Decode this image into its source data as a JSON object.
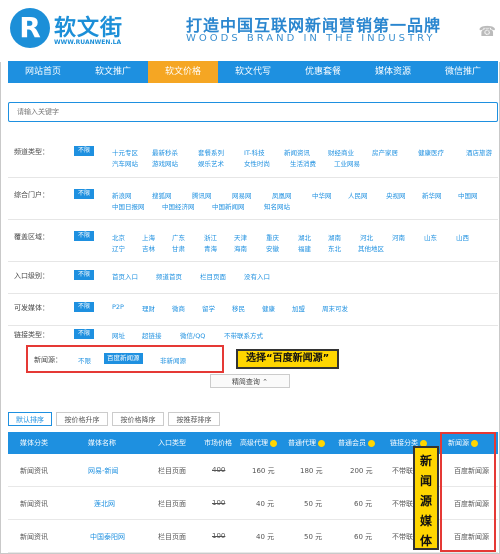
{
  "header": {
    "logo_text": "软文街",
    "logo_url": "WWW.RUANWEN.LA",
    "logo_mark": "R",
    "slogan": "打造中国互联网新闻营销第一品牌",
    "slogan_en": "WOODS BRAND IN THE INDUSTRY"
  },
  "nav": {
    "items": [
      "网站首页",
      "软文推广",
      "软文价格",
      "软文代写",
      "优惠套餐",
      "媒体资源",
      "微信推广"
    ]
  },
  "search": {
    "placeholder": "请输入关键字"
  },
  "filters": {
    "channel": {
      "label": "频道类型：",
      "all": "不限",
      "row1": [
        "十元专区",
        "最新秒杀",
        "套餐系列",
        "IT-科技",
        "新闻资讯",
        "财经商业",
        "房产家居",
        "健康医疗",
        "酒店旅游"
      ],
      "row2": [
        "汽车网站",
        "游戏网站",
        "娱乐艺术",
        "女性时尚",
        "生活消费",
        "工业网易"
      ]
    },
    "portal": {
      "label": "综合门户：",
      "all": "不限",
      "row1": [
        "新浪网",
        "搜狐网",
        "腾讯网",
        "网易网",
        "凤凰网",
        "中华网",
        "人民网",
        "央视网",
        "新华网",
        "中国网"
      ],
      "row2": [
        "中国日报网",
        "中国经济网",
        "中国新闻网",
        "知名网站"
      ]
    },
    "region": {
      "label": "覆盖区域：",
      "all": "不限",
      "row1": [
        "北京",
        "上海",
        "广东",
        "浙江",
        "天津",
        "重庆",
        "湖北",
        "湖南",
        "河北",
        "河南",
        "山东",
        "山西"
      ],
      "row2": [
        "辽宁",
        "吉林",
        "甘肃",
        "青海",
        "海南",
        "安徽",
        "福建",
        "东北",
        "其他地区"
      ]
    },
    "entry": {
      "label": "入口级别：",
      "all": "不限",
      "options": [
        "首页入口",
        "频道首页",
        "栏目页面",
        "没有入口"
      ]
    },
    "media": {
      "label": "可发媒体：",
      "all": "不限",
      "options": [
        "P2P",
        "理财",
        "微商",
        "留学",
        "移民",
        "健康",
        "加盟",
        "周末可发"
      ]
    },
    "link": {
      "label": "链接类型：",
      "all": "不限",
      "options": [
        "网址",
        "超链接",
        "微信/QQ",
        "不带联系方式"
      ]
    },
    "source": {
      "label": "新闻源：",
      "all": "不限",
      "selected": "百度新闻源",
      "other": "非新闻源"
    },
    "precise_label": "精简查询",
    "callout": "选择“百度新闻源”"
  },
  "sort_tabs": [
    "默认排序",
    "按价格升序",
    "按价格降序",
    "按推荐排序"
  ],
  "table": {
    "headers": [
      "媒体分类",
      "媒体名称",
      "入口类型",
      "市场价格",
      "高级代理",
      "普通代理",
      "普通会员",
      "链接分类",
      "新闻源"
    ],
    "rows": [
      {
        "category": "新闻资讯",
        "name": "网易-新闻",
        "entry": "栏目页面",
        "market": "400",
        "senior": "160 元",
        "agent": "180 元",
        "member": "200 元",
        "link": "不带联系",
        "source": "百度新闻源"
      },
      {
        "category": "新闻资讯",
        "name": "莲北网",
        "entry": "栏目页面",
        "market": "100",
        "senior": "40 元",
        "agent": "50 元",
        "member": "60 元",
        "link": "不带联系",
        "source": "百度新闻源"
      },
      {
        "category": "新闻资讯",
        "name": "中国泰阳网",
        "entry": "栏目页面",
        "market": "100",
        "senior": "40 元",
        "agent": "50 元",
        "member": "60 元",
        "link": "不带联系",
        "source": "百度新闻源"
      }
    ]
  },
  "media_callout": [
    "新",
    "闻",
    "源",
    "媒",
    "体"
  ],
  "colors": {
    "primary": "#1e90e0",
    "accent": "#f5a623",
    "highlight": "#ffd600",
    "mark": "#e53935"
  }
}
